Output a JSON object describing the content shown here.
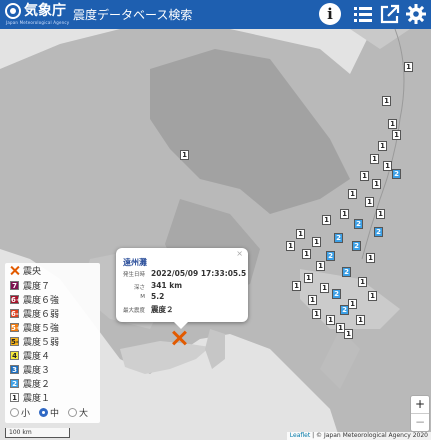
{
  "header": {
    "agency_name": "気象庁",
    "agency_en": "Japan Meteorological Agency",
    "app_title": "震度データベース検索",
    "info_glyph": "i"
  },
  "popup": {
    "close_glyph": "×",
    "region": "遠州灘",
    "rows": [
      {
        "label": "発生日時",
        "value": "2022/05/09 17:33:05.5"
      },
      {
        "label": "深さ",
        "value": "341 km"
      },
      {
        "label": "M",
        "value": "5.2"
      },
      {
        "label": "最大震度",
        "value": "震度２"
      }
    ]
  },
  "legend": {
    "epicenter_label": "震央",
    "items": [
      {
        "swatch": "7",
        "label": "震度７",
        "bg": "#7d1150",
        "fg": "#ffffff"
      },
      {
        "swatch": "6+",
        "label": "震度６強",
        "bg": "#a5122a",
        "fg": "#ffffff"
      },
      {
        "swatch": "6-",
        "label": "震度６弱",
        "bg": "#e0411f",
        "fg": "#ffffff"
      },
      {
        "swatch": "5+",
        "label": "震度５強",
        "bg": "#f07c12",
        "fg": "#ffffff"
      },
      {
        "swatch": "5-",
        "label": "震度５弱",
        "bg": "#f6b318",
        "fg": "#222222"
      },
      {
        "swatch": "4",
        "label": "震度４",
        "bg": "#f5e93a",
        "fg": "#222222"
      },
      {
        "swatch": "3",
        "label": "震度３",
        "bg": "#1e6fbf",
        "fg": "#ffffff"
      },
      {
        "swatch": "2",
        "label": "震度２",
        "bg": "#3da0e6",
        "fg": "#ffffff"
      },
      {
        "swatch": "1",
        "label": "震度１",
        "bg": "#ffffff",
        "fg": "#222222"
      }
    ],
    "sizes": [
      {
        "label": "小",
        "selected": false
      },
      {
        "label": "中",
        "selected": true
      },
      {
        "label": "大",
        "selected": false
      }
    ]
  },
  "map": {
    "zoom_in": "+",
    "zoom_out": "−",
    "scale_label": "100 km",
    "attribution_leaflet": "Leaflet",
    "attribution_rest": " | © Japan Meteorological Agency 2020",
    "intensity_markers": [
      {
        "intensity": "1"
      },
      {
        "intensity": "1"
      },
      {
        "intensity": "1"
      },
      {
        "intensity": "1"
      },
      {
        "intensity": "1"
      },
      {
        "intensity": "1"
      },
      {
        "intensity": "1"
      },
      {
        "intensity": "1"
      },
      {
        "intensity": "2"
      },
      {
        "intensity": "1"
      },
      {
        "intensity": "1"
      },
      {
        "intensity": "1"
      },
      {
        "intensity": "1"
      },
      {
        "intensity": "2"
      },
      {
        "intensity": "1"
      },
      {
        "intensity": "2"
      },
      {
        "intensity": "1"
      },
      {
        "intensity": "2"
      },
      {
        "intensity": "1"
      },
      {
        "intensity": "1"
      },
      {
        "intensity": "2"
      },
      {
        "intensity": "1"
      },
      {
        "intensity": "2"
      },
      {
        "intensity": "1"
      },
      {
        "intensity": "1"
      },
      {
        "intensity": "2"
      },
      {
        "intensity": "1"
      },
      {
        "intensity": "1"
      },
      {
        "intensity": "1"
      },
      {
        "intensity": "1"
      },
      {
        "intensity": "2"
      },
      {
        "intensity": "1"
      },
      {
        "intensity": "1"
      },
      {
        "intensity": "1"
      },
      {
        "intensity": "2"
      },
      {
        "intensity": "1"
      },
      {
        "intensity": "1"
      },
      {
        "intensity": "1"
      },
      {
        "intensity": "1"
      },
      {
        "intensity": "1"
      },
      {
        "intensity": "1"
      },
      {
        "intensity": "1"
      }
    ]
  }
}
